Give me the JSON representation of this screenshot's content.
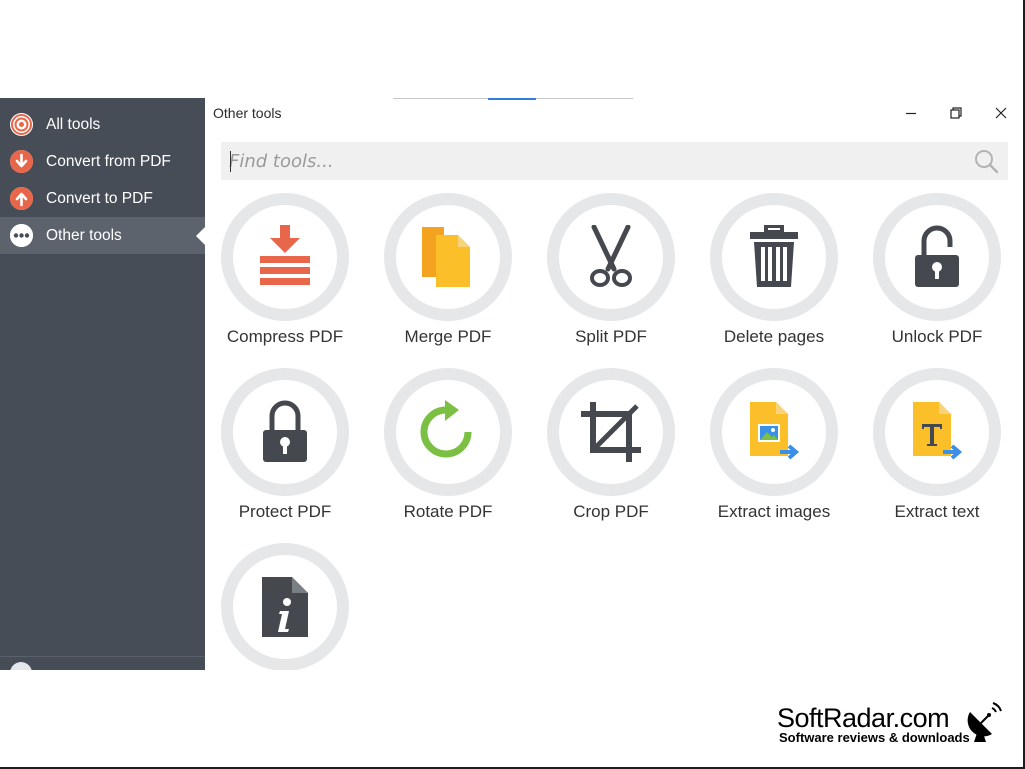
{
  "window": {
    "title": "Other tools"
  },
  "sidebar": {
    "items": [
      {
        "label": "All tools",
        "icon": "all-tools-icon"
      },
      {
        "label": "Convert from PDF",
        "icon": "arrow-down-icon"
      },
      {
        "label": "Convert to PDF",
        "icon": "arrow-up-icon"
      },
      {
        "label": "Other tools",
        "icon": "more-dots-icon"
      }
    ],
    "active_index": 3
  },
  "search": {
    "placeholder": "Find tools...",
    "value": ""
  },
  "tools": [
    {
      "label": "Compress PDF",
      "icon": "compress-icon"
    },
    {
      "label": "Merge PDF",
      "icon": "merge-icon"
    },
    {
      "label": "Split PDF",
      "icon": "scissors-icon"
    },
    {
      "label": "Delete pages",
      "icon": "trash-icon"
    },
    {
      "label": "Unlock PDF",
      "icon": "unlock-icon"
    },
    {
      "label": "Protect PDF",
      "icon": "lock-icon"
    },
    {
      "label": "Rotate PDF",
      "icon": "rotate-icon"
    },
    {
      "label": "Crop PDF",
      "icon": "crop-icon"
    },
    {
      "label": "Extract images",
      "icon": "extract-images-icon"
    },
    {
      "label": "Extract text",
      "icon": "extract-text-icon"
    },
    {
      "label": "",
      "icon": "pdf-info-icon"
    }
  ],
  "colors": {
    "sidebar_bg": "#474d57",
    "sidebar_active": "#5d636d",
    "accent_red": "#e8664a",
    "accent_yellow": "#fbbf2a",
    "accent_green": "#7bc043",
    "accent_blue": "#3a8fe6",
    "icon_dark": "#45494f"
  },
  "watermark": {
    "brand": "SoftRadar.com",
    "tagline": "Software reviews & downloads"
  }
}
